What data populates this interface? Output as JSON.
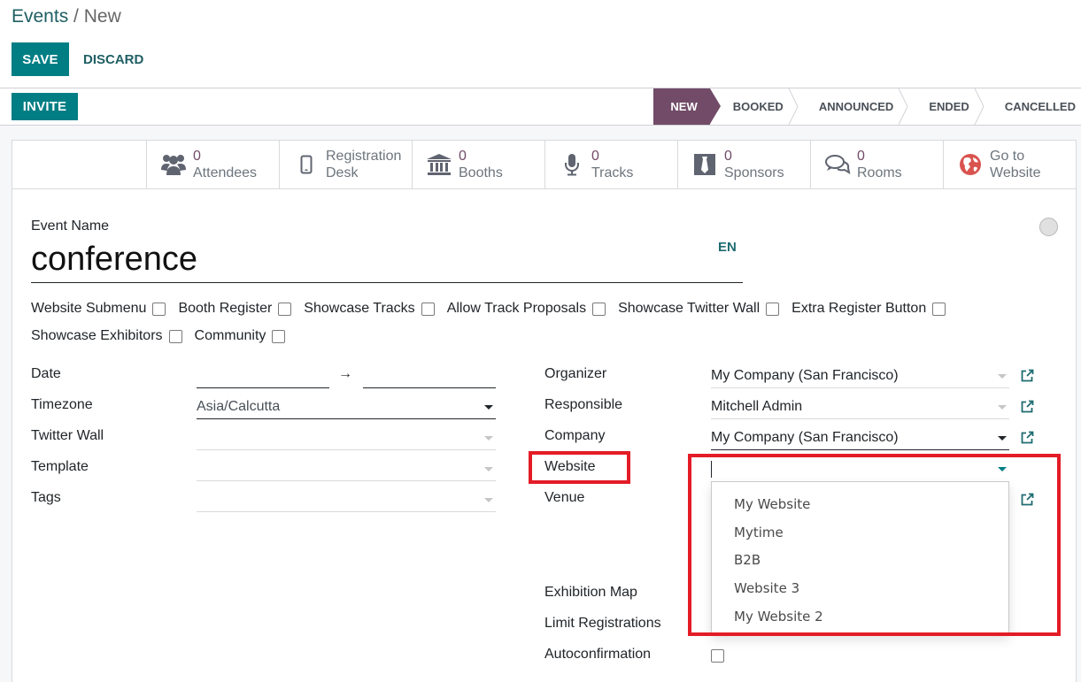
{
  "breadcrumb": {
    "root": "Events",
    "separator": " / ",
    "current": "New"
  },
  "toolbar": {
    "save_label": "SAVE",
    "discard_label": "DISCARD"
  },
  "statusbar": {
    "invite_label": "INVITE",
    "stages": [
      {
        "label": "NEW",
        "active": true
      },
      {
        "label": "BOOKED",
        "active": false
      },
      {
        "label": "ANNOUNCED",
        "active": false
      },
      {
        "label": "ENDED",
        "active": false
      },
      {
        "label": "CANCELLED",
        "active": false
      }
    ]
  },
  "stat_buttons": [
    {
      "icon": "users-icon",
      "value": "0",
      "label": "Attendees"
    },
    {
      "icon": "mobile-icon",
      "value": "",
      "label": "Registration",
      "label2": "Desk"
    },
    {
      "icon": "bank-icon",
      "value": "0",
      "label": "Booths"
    },
    {
      "icon": "microphone-icon",
      "value": "0",
      "label": "Tracks"
    },
    {
      "icon": "tie-icon",
      "value": "0",
      "label": "Sponsors"
    },
    {
      "icon": "comments-icon",
      "value": "0",
      "label": "Rooms"
    },
    {
      "icon": "globe-icon",
      "value": "",
      "label": "Go to",
      "label2": "Website"
    }
  ],
  "form": {
    "event_name_label": "Event Name",
    "event_name_value": "conference",
    "lang_label": "EN",
    "checkboxes_row1": [
      {
        "label": "Website Submenu",
        "checked": false
      },
      {
        "label": "Booth Register",
        "checked": false
      },
      {
        "label": "Showcase Tracks",
        "checked": false
      },
      {
        "label": "Allow Track Proposals",
        "checked": false
      },
      {
        "label": "Showcase Twitter Wall",
        "checked": false
      },
      {
        "label": "Extra Register Button",
        "checked": false
      }
    ],
    "checkboxes_row2": [
      {
        "label": "Showcase Exhibitors",
        "checked": false
      },
      {
        "label": "Community",
        "checked": false
      }
    ],
    "left_fields": {
      "date_label": "Date",
      "date_arrow": "→",
      "date_start": "",
      "date_end": "",
      "timezone_label": "Timezone",
      "timezone_value": "Asia/Calcutta",
      "twitter_wall_label": "Twitter Wall",
      "twitter_wall_value": "",
      "template_label": "Template",
      "template_value": "",
      "tags_label": "Tags",
      "tags_value": ""
    },
    "right_fields": {
      "organizer_label": "Organizer",
      "organizer_value": "My Company (San Francisco)",
      "responsible_label": "Responsible",
      "responsible_value": "Mitchell Admin",
      "company_label": "Company",
      "company_value": "My Company (San Francisco)",
      "website_label": "Website",
      "website_value": "",
      "venue_label": "Venue",
      "exhibition_map_label": "Exhibition Map",
      "limit_registrations_label": "Limit Registrations",
      "autoconfirmation_label": "Autoconfirmation",
      "autoconfirmation_checked": false
    },
    "website_dropdown_options": [
      "My Website",
      "Mytime",
      "B2B",
      "Website 3",
      "My Website 2"
    ]
  },
  "colors": {
    "primary": "#017e84",
    "stage_active": "#714b67",
    "stat_value": "#714b67",
    "highlight": "#e31c26"
  }
}
